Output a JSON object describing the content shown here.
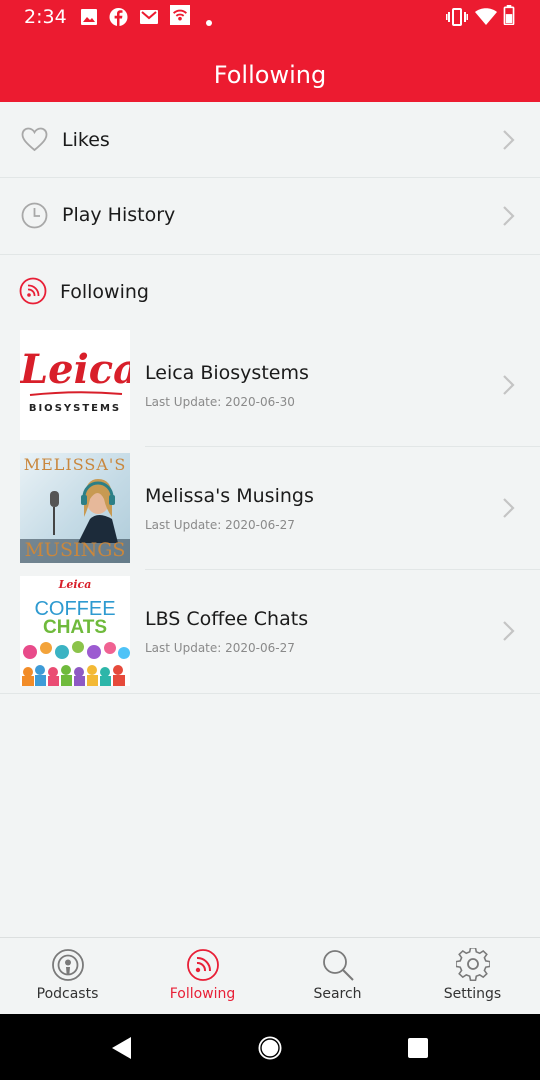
{
  "status_bar": {
    "time": "2:34",
    "left_icons": [
      "image-icon",
      "facebook-icon",
      "gmail-icon",
      "wifi-hotspot-icon",
      "dot-icon"
    ],
    "right_icons": [
      "vibrate-icon",
      "wifi-icon",
      "battery-icon"
    ]
  },
  "app_bar": {
    "title": "Following"
  },
  "menu": {
    "likes": {
      "label": "Likes",
      "icon": "heart-icon"
    },
    "history": {
      "label": "Play History",
      "icon": "clock-icon"
    }
  },
  "following_section": {
    "label": "Following",
    "icon": "rss-icon"
  },
  "podcasts": [
    {
      "title": "Leica Biosystems",
      "last_update": "Last Update: 2020-06-30",
      "thumb": {
        "logo": "Leica",
        "sub": "BIOSYSTEMS"
      }
    },
    {
      "title": "Melissa's Musings",
      "last_update": "Last Update: 2020-06-27",
      "thumb": {
        "top": "MELISSA'S",
        "bottom": "MUSINGS"
      }
    },
    {
      "title": "LBS Coffee Chats",
      "last_update": "Last Update: 2020-06-27",
      "thumb": {
        "logo": "Leica",
        "line1": "COFFEE",
        "line2": "CHATS"
      }
    }
  ],
  "bottom_nav": [
    {
      "label": "Podcasts",
      "icon": "podcast-icon",
      "active": false
    },
    {
      "label": "Following",
      "icon": "rss-icon",
      "active": true
    },
    {
      "label": "Search",
      "icon": "search-icon",
      "active": false
    },
    {
      "label": "Settings",
      "icon": "gear-icon",
      "active": false
    }
  ],
  "colors": {
    "brand": "#EC1B30",
    "background": "#F2F4F4",
    "active_nav": "#E81F36"
  }
}
